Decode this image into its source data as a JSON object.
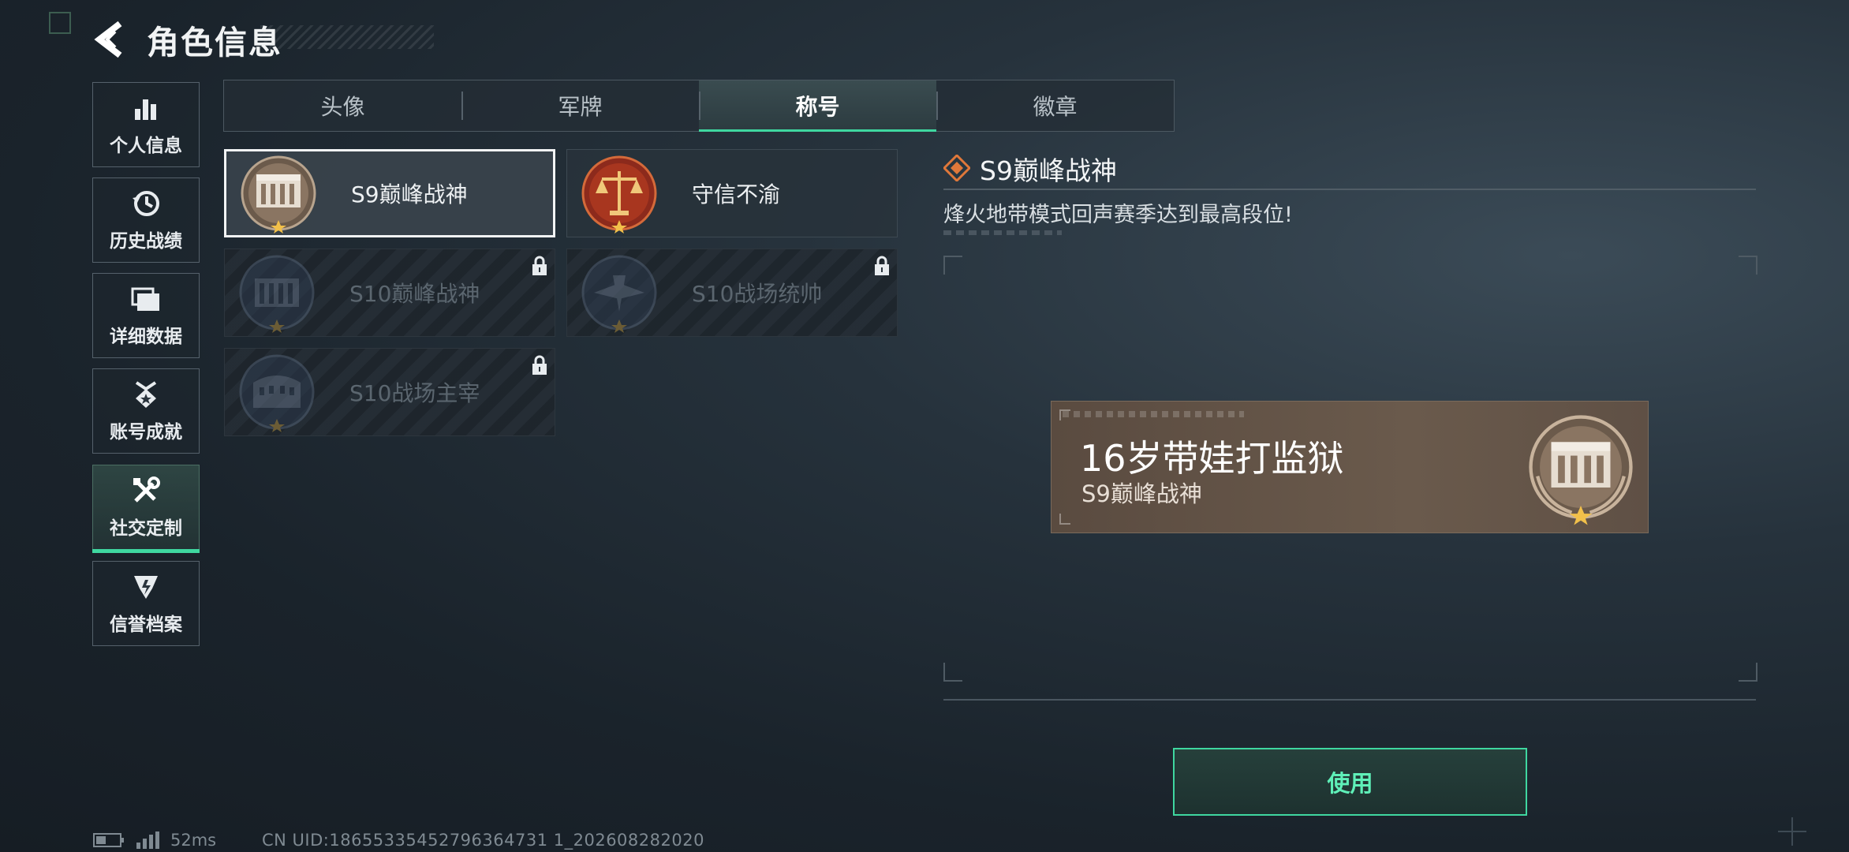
{
  "header": {
    "title": "角色信息"
  },
  "sidebar": {
    "items": [
      {
        "label": "个人信息",
        "icon": "bar-chart-icon"
      },
      {
        "label": "历史战绩",
        "icon": "history-clock-icon"
      },
      {
        "label": "详细数据",
        "icon": "folder-stack-icon"
      },
      {
        "label": "账号成就",
        "icon": "achievement-badge-icon"
      },
      {
        "label": "社交定制",
        "icon": "tools-icon",
        "active": true
      },
      {
        "label": "信誉档案",
        "icon": "credit-shield-icon"
      }
    ]
  },
  "tabs": [
    {
      "label": "头像"
    },
    {
      "label": "军牌"
    },
    {
      "label": "称号",
      "active": true
    },
    {
      "label": "徽章"
    }
  ],
  "titles": [
    {
      "name": "S9巅峰战神",
      "selected": true,
      "locked": false,
      "emblem": "fortress-emblem"
    },
    {
      "name": "守信不渝",
      "selected": false,
      "locked": false,
      "emblem": "scales-emblem"
    },
    {
      "name": "S10巅峰战神",
      "selected": false,
      "locked": true,
      "emblem": "fortress-emblem"
    },
    {
      "name": "S10战场统帅",
      "selected": false,
      "locked": true,
      "emblem": "aircraft-emblem"
    },
    {
      "name": "S10战场主宰",
      "selected": false,
      "locked": true,
      "emblem": "colosseum-emblem"
    }
  ],
  "detail": {
    "title": "S9巅峰战神",
    "description": "烽火地带模式回声赛季达到最高段位!"
  },
  "preview": {
    "nickname": "16岁带娃打监狱",
    "title": "S9巅峰战神"
  },
  "use_button": {
    "label": "使用"
  },
  "status": {
    "ping": "52ms",
    "uid": "CN UID:18655335452796364731 1_202608282020"
  },
  "colors": {
    "accent": "#3fd7a0",
    "background": "#1e2830",
    "banner": "#635345",
    "detail_icon": "#e0783a"
  }
}
